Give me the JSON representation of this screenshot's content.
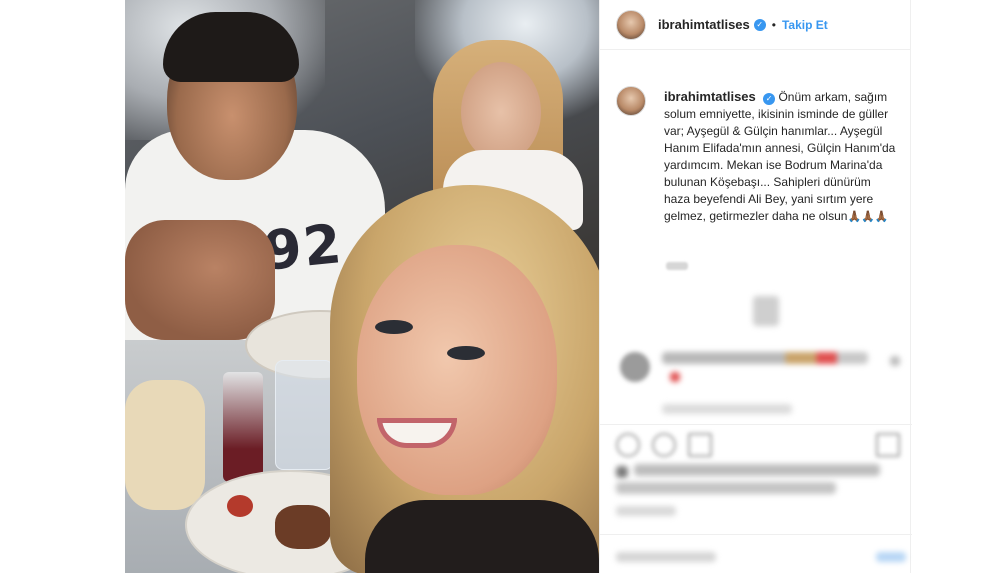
{
  "post": {
    "username": "ibrahimtatlises",
    "verified_glyph": "✓",
    "separator": "•",
    "follow_label": "Takip Et",
    "caption": "Önüm arkam, sağım solum emniyette, ikisinin isminde de güller var; Ayşegül & Gülçin hanımlar... Ayşegül Hanım Elifada'mın annesi, Gülçin Hanım'da yardımcım. Mekan ise Bodrum Marina'da bulunan Köşebaşı... Sahipleri dünürüm haza beyefendi Ali Bey, yani sırtım yere gelmez, getirmezler daha ne olsun",
    "caption_emojis": "🙏🏾🙏🏾🙏🏾",
    "photo_shirt_text": "1992"
  },
  "colors": {
    "link_blue": "#3897f0",
    "text": "#262626",
    "border": "#efefef"
  },
  "icons": {
    "verified": "verified-badge-icon",
    "heart": "heart-icon",
    "comment": "comment-icon",
    "share": "share-icon",
    "save": "bookmark-icon"
  }
}
